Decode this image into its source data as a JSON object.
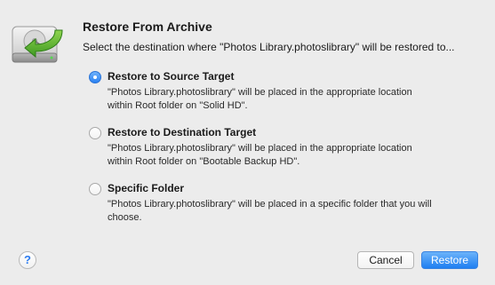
{
  "dialog": {
    "title": "Restore From Archive",
    "subtitle": "Select the destination where \"Photos Library.photoslibrary\" will be restored to...",
    "icon": "hard-drive-restore-icon"
  },
  "options": [
    {
      "label": "Restore to Source Target",
      "selected": true,
      "desc_line1": "\"Photos Library.photoslibrary\" will be placed in the appropriate location",
      "desc_line2": "within Root folder on \"Solid HD\"."
    },
    {
      "label": "Restore to Destination Target",
      "selected": false,
      "desc_line1": "\"Photos Library.photoslibrary\" will be placed in the appropriate location",
      "desc_line2": "within Root folder on \"Bootable Backup HD\"."
    },
    {
      "label": "Specific Folder",
      "selected": false,
      "desc_line1": "\"Photos Library.photoslibrary\" will be placed in a specific folder that you will",
      "desc_line2": "choose."
    }
  ],
  "buttons": {
    "help_label": "?",
    "cancel_label": "Cancel",
    "restore_label": "Restore"
  },
  "colors": {
    "accent": "#2b82f3",
    "background": "#ececec",
    "arrow": "#5fb832"
  }
}
